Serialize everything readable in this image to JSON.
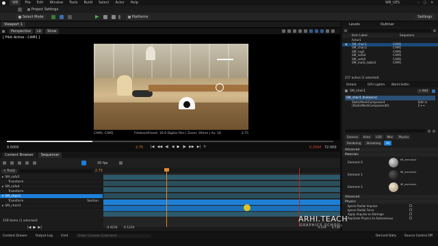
{
  "menu": {
    "project_tab": "WB",
    "items": [
      "File",
      "Edit",
      "Window",
      "Tools",
      "Build",
      "Select",
      "Actor",
      "Help"
    ],
    "window_title": "WB_UES"
  },
  "toolbar": {
    "project_settings": "Project Settings",
    "select_mode": "Select Mode",
    "platforms": "Platforms",
    "settings": "Settings"
  },
  "viewport": {
    "tab": "Viewport 1",
    "perspective": "Perspective",
    "lit": "Lit",
    "show": "Show",
    "pilot_label": "[ Pilot Active - CAM1 ]",
    "camera_caption_left": "CAM1: CAM1",
    "camera_caption_right": "FilmbackPreset: 16:9 Digital Film | Zoom: 30mm | Av: 18",
    "frame_right": "2:75",
    "time_left": "0.0000",
    "time_mid": "2.75",
    "time_right_a": "0.2500",
    "time_right_b": "72.000"
  },
  "outliner": {
    "tab_levels": "Levels",
    "tab_outliner": "Outliner",
    "col_item": "Item Label",
    "col_type": "Sequence",
    "rows": [
      {
        "label": "Actor1",
        "type": ""
      },
      {
        "label": "SM_chair1",
        "type": "CAM1",
        "selected": true
      },
      {
        "label": "SM_chair2",
        "type": "CAM1"
      },
      {
        "label": "SM_rug2",
        "type": "CAM1"
      },
      {
        "label": "SM_sofa4",
        "type": "CAM1"
      },
      {
        "label": "SM_sofa5",
        "type": "CAM1"
      },
      {
        "label": "SM_marb_table2",
        "type": "CAM1"
      }
    ],
    "count": "217 actors (1 selected)"
  },
  "details": {
    "tab_details": "Details",
    "tab_gpu": "GPU Lightm.",
    "tab_world": "World Settin.",
    "object": "SM_chair1",
    "add_label": "+ Add",
    "instance": "SM_chair1 (Instance)",
    "component": "StaticMeshComponent (StaticMeshComponent0)",
    "edit_cpp": "Edit in C++",
    "search_placeholder": "Search",
    "filters": [
      "General",
      "Actor",
      "LOD",
      "Misc",
      "Physics",
      "Rendering",
      "Streaming",
      "All"
    ],
    "sections": {
      "advanced": "Advanced",
      "materials": "Materials",
      "advanced2": "Advanced",
      "physics": "Physics"
    },
    "elements": [
      {
        "label": "Element 0",
        "name": "MI_armchair"
      },
      {
        "label": "Element 1",
        "name": "MI_armchair"
      },
      {
        "label": "Element 2",
        "name": "MI_armchair"
      }
    ],
    "physics_props": [
      "Ignore Radial Impulse",
      "Ignore Radial Force",
      "Apply Impulse on Damage",
      "Replicate Physics to Autonomous"
    ],
    "derived_data": "Derived Data",
    "source_control": "Source Control Off"
  },
  "sequencer": {
    "tab_content": "Content Browser",
    "tab_sequencer": "Sequencer",
    "add_track": "+ Track",
    "search_placeholder": "Search Tracks",
    "fps": "30 fps",
    "current_time": "2.75",
    "tracks": [
      {
        "label": "SM_sofa5",
        "kind": "actor"
      },
      {
        "label": "Transform",
        "kind": "sub"
      },
      {
        "label": "SM_sofa4",
        "kind": "actor"
      },
      {
        "label": "Transform",
        "kind": "sub"
      },
      {
        "label": "SM_chair1",
        "kind": "actor",
        "selected": true
      },
      {
        "label": "Transform",
        "kind": "sub",
        "extra": "Section"
      },
      {
        "label": "SM_chair2",
        "kind": "actor"
      }
    ],
    "items_count": "159 items (1 selected)",
    "range_left_a": "-0.4234",
    "range_left_b": "-0.1234",
    "range_right_a": "4.234",
    "range_right_b": "4.734"
  },
  "statusbar": {
    "content_drawer": "Content Drawer",
    "output_log": "Output Log",
    "cmd": "Cmd",
    "console_placeholder": "Enter Console Command"
  },
  "watermark": {
    "line1": "ARHI.TEACH",
    "line2": "GRAPHICS SCHOOL"
  },
  "colors": {
    "accent_blue": "#1e7fd6",
    "selection_blue": "#1a4a7a",
    "play_head_orange": "#e08a2c",
    "key_yellow": "#e3c21a",
    "panel_bg": "#1c1c1c"
  }
}
